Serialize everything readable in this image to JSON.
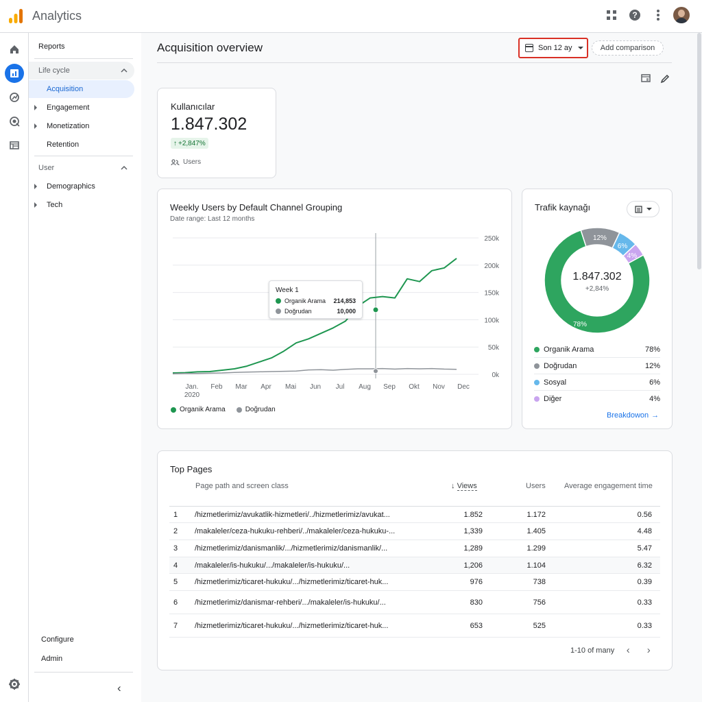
{
  "app": {
    "title": "Analytics"
  },
  "header": {
    "page_title": "Acquisition overview",
    "date_range": "Son 12 ay",
    "add_comparison": "Add comparison"
  },
  "nav": {
    "reports": "Reports",
    "lifecycle": "Life cycle",
    "acquisition": "Acquisition",
    "engagement": "Engagement",
    "monetization": "Monetization",
    "retention": "Retention",
    "user": "User",
    "demographics": "Demographics",
    "tech": "Tech",
    "configure": "Configure",
    "admin": "Admin"
  },
  "icons": {
    "logo": "analytics-logo",
    "apps": "apps-grid-icon",
    "help": "help-icon",
    "more": "more-vert-icon",
    "home": "home-icon",
    "reports": "reports-icon",
    "explore": "explore-icon",
    "advertising": "advertising-icon",
    "configure": "configure-list-icon",
    "settings": "gear-icon"
  },
  "users_card": {
    "title": "Kullanıcılar",
    "value": "1.847.302",
    "delta": "+2,847%",
    "label": "Users"
  },
  "line_card": {
    "title": "Weekly Users by Default Channel Grouping",
    "date_range": "Date range: Last 12 months",
    "tooltip": {
      "week": "Week 1",
      "series1": "Organik Arama",
      "value1": "214,853",
      "series2": "Doğrudan",
      "value2": "10,000"
    },
    "legend": [
      "Organik Arama",
      "Doğrudan"
    ]
  },
  "pie_card": {
    "title": "Trafik kaynağı",
    "center_value": "1.847.302",
    "center_delta": "+2,84%",
    "rows": [
      {
        "label": "Organik Arama",
        "pct": "78%",
        "color": "#2ea55f"
      },
      {
        "label": "Doğrudan",
        "pct": "12%",
        "color": "#8f949a"
      },
      {
        "label": "Sosyal",
        "pct": "6%",
        "color": "#66b8eb"
      },
      {
        "label": "Diğer",
        "pct": "4%",
        "color": "#c9a5ef"
      }
    ],
    "breakdown": "Breakdowon"
  },
  "top_pages": {
    "title": "Top Pages",
    "headers": [
      "Page path and screen class",
      "Views",
      "Users",
      "Average engagement time"
    ],
    "rows": [
      {
        "rank": "1",
        "path": "/hizmetlerimiz/avukatlik-hizmetleri/../hizmetlerimiz/avukat...",
        "views": "1.852",
        "users": "1.172",
        "avg": "0.56"
      },
      {
        "rank": "2",
        "path": "/makaleler/ceza-hukuku-rehberi/../makaleler/ceza-hukuku-...",
        "views": "1,339",
        "users": "1.405",
        "avg": "4.48"
      },
      {
        "rank": "3",
        "path": "/hizmetlerimiz/danismanlik/.../hizmetlerimiz/danismanlik/...",
        "views": "1,289",
        "users": "1.299",
        "avg": "5.47"
      },
      {
        "rank": "4",
        "path": "/makaleler/is-hukuku/.../makaleler/is-hukuku/...",
        "views": "1,206",
        "users": "1.104",
        "avg": "6.32"
      },
      {
        "rank": "5",
        "path": "/hizmetlerimiz/ticaret-hukuku/.../hizmetlerimiz/ticaret-huk...",
        "views": "976",
        "users": "738",
        "avg": "0.39"
      },
      {
        "rank": "6",
        "path": "/hizmetlerimiz/danismar-rehberi/.../makaleler/is-hukuku/...",
        "views": "830",
        "users": "756",
        "avg": "0.33"
      },
      {
        "rank": "7",
        "path": "/hizmetlerimiz/ticaret-hukuku/.../hizmetlerimiz/ticaret-huk...",
        "views": "653",
        "users": "525",
        "avg": "0.33"
      }
    ],
    "pagination": "1-10 of many"
  },
  "chart_data": [
    {
      "type": "line",
      "title": "Weekly Users by Default Channel Grouping",
      "subtitle": "Date range: Last 12 months",
      "x_ticks": [
        "Jan. 2020",
        "Feb",
        "Mar",
        "Apr",
        "Mai",
        "Jun",
        "Jul",
        "Aug",
        "Sep",
        "Okt",
        "Nov",
        "Dec"
      ],
      "y_ticks": [
        "0k",
        "50k",
        "100k",
        "150k",
        "200k",
        "250k"
      ],
      "ylim": [
        0,
        250000
      ],
      "x": [
        0,
        0.5,
        1,
        1.5,
        2,
        2.5,
        3,
        3.5,
        4,
        4.5,
        5,
        5.5,
        6,
        6.5,
        7,
        7.5,
        8,
        8.5,
        9,
        9.5,
        10,
        10.5,
        11,
        11.5
      ],
      "series": [
        {
          "name": "Organik Arama",
          "color": "#1e9650",
          "values": [
            2500,
            3000,
            4500,
            5000,
            7500,
            10000,
            15000,
            22500,
            30000,
            42500,
            57500,
            65000,
            75000,
            85000,
            97500,
            125000,
            140000,
            142500,
            140000,
            175000,
            170000,
            190000,
            195000,
            212500
          ]
        },
        {
          "name": "Doğrudan",
          "color": "#8f949a",
          "values": [
            1000,
            1500,
            1500,
            2000,
            2500,
            3500,
            4000,
            4500,
            5000,
            5500,
            6000,
            8000,
            8500,
            7500,
            9000,
            10000,
            10000,
            10500,
            9500,
            10500,
            10000,
            10500,
            9500,
            9000
          ]
        }
      ],
      "grid": true,
      "legend_position": "bottom-left",
      "highlight": {
        "label": "Week 1",
        "x": 8,
        "organik_arama": 214853,
        "dogrudan": 10000
      }
    },
    {
      "type": "pie",
      "title": "Trafik kaynağı",
      "center_value": "1.847.302",
      "center_delta": "+2,84%",
      "categories": [
        "Organik Arama",
        "Doğrudan",
        "Sosyal",
        "Diğer"
      ],
      "values": [
        78,
        12,
        6,
        4
      ],
      "colors": [
        "#2ea55f",
        "#8f949a",
        "#66b8eb",
        "#c9a5ef"
      ],
      "legend_position": "bottom"
    }
  ]
}
